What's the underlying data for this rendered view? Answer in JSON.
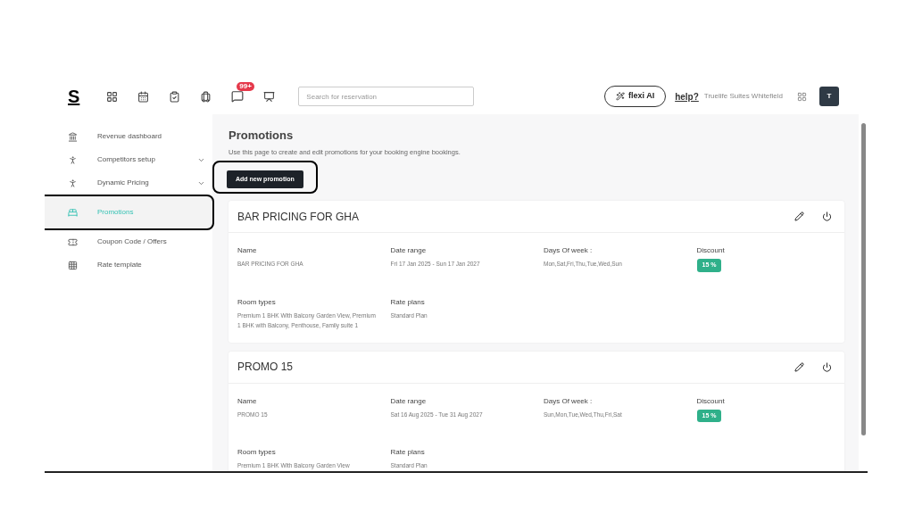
{
  "header": {
    "logo": "S",
    "notification_badge": "99+",
    "search": {
      "placeholder": "Search for reservation"
    },
    "ai_button": "flexi AI",
    "help_link": "help?",
    "property": "Truelife Suites Whitefield",
    "avatar": "T"
  },
  "sidebar": {
    "items": [
      {
        "label": "Revenue dashboard",
        "kind": "bank",
        "expandable": false,
        "selected": false,
        "annotated": false
      },
      {
        "label": "Competitors setup",
        "kind": "person",
        "expandable": true,
        "selected": false,
        "annotated": false
      },
      {
        "label": "Dynamic Pricing",
        "kind": "person",
        "expandable": true,
        "selected": false,
        "annotated": false
      },
      {
        "label": "Promotions",
        "kind": "bed",
        "expandable": false,
        "selected": true,
        "annotated": true
      },
      {
        "label": "Coupon Code / Offers",
        "kind": "coupon",
        "expandable": false,
        "selected": false,
        "annotated": false
      },
      {
        "label": "Rate template",
        "kind": "grid",
        "expandable": false,
        "selected": false,
        "annotated": false
      }
    ]
  },
  "page": {
    "title": "Promotions",
    "description": "Use this page to create and edit promotions for your booking engine bookings.",
    "add_button": {
      "label": "Add new promotion",
      "annotated": true
    }
  },
  "promotions": [
    {
      "title": "BAR PRICING FOR GHA",
      "fields": [
        {
          "label": "Name",
          "value": "BAR PRICING FOR GHA",
          "kind": "text"
        },
        {
          "label": "Date range",
          "value": "Fri 17 Jan 2025 - Sun 17 Jan 2027",
          "kind": "text"
        },
        {
          "label": "Days Of week :",
          "value": "Mon,Sat,Fri,Thu,Tue,Wed,Sun",
          "kind": "text"
        },
        {
          "label": "Discount",
          "value": "15 %",
          "kind": "badge"
        },
        {
          "label": "Room types",
          "value": "Premium 1 BHK With Balcony Garden View, Premium 1 BHK with Balcony, Penthouse, Family suite 1",
          "kind": "text"
        },
        {
          "label": "Rate plans",
          "value": "Standard Plan",
          "kind": "text"
        }
      ]
    },
    {
      "title": "PROMO 15",
      "fields": [
        {
          "label": "Name",
          "value": "PROMO 15",
          "kind": "text"
        },
        {
          "label": "Date range",
          "value": "Sat 16 Aug 2025 - Tue 31 Aug 2027",
          "kind": "text"
        },
        {
          "label": "Days Of week :",
          "value": "Sun,Mon,Tue,Wed,Thu,Fri,Sat",
          "kind": "text"
        },
        {
          "label": "Discount",
          "value": "15 %",
          "kind": "badge"
        },
        {
          "label": "Room types",
          "value": "Premium 1 BHK With Balcony Garden View",
          "kind": "text"
        },
        {
          "label": "Rate plans",
          "value": "Standard Plan",
          "kind": "text"
        }
      ]
    }
  ]
}
